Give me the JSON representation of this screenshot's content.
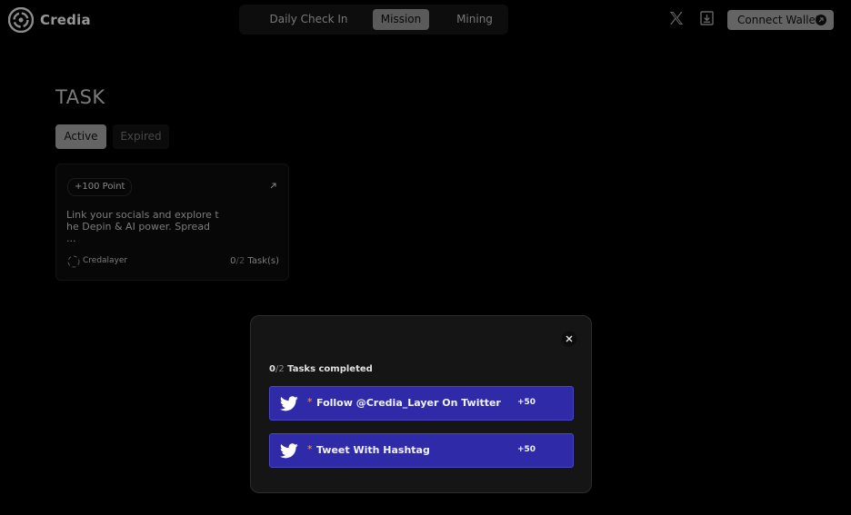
{
  "header": {
    "brand": "Credia",
    "nav_tabs": [
      {
        "label": "Daily Check In",
        "active": false
      },
      {
        "label": "Mission",
        "active": true
      },
      {
        "label": "Mining",
        "active": false
      }
    ],
    "connect_wallet": "Connect Wallet",
    "icons": [
      "x-logo-icon",
      "download-icon",
      "arrow-circle-icon"
    ]
  },
  "task": {
    "title": "TASK",
    "filters": [
      "Active",
      "Expired"
    ],
    "active_filter": "Active",
    "card": {
      "points": "+100 Point",
      "description": "Link your socials and explore the Depin & AI power. Spread ...",
      "owner": "Credalayer",
      "progress_done": "0",
      "progress_total": "/2",
      "progress_suffix": " Task(s)"
    }
  },
  "modal": {
    "completed_done": "0",
    "completed_total": "/2",
    "completed_suffix": " Tasks completed",
    "tasks": [
      {
        "label": "Follow @Credia_Layer On Twitter",
        "reward": "+50",
        "icon": "twitter-bird-icon"
      },
      {
        "label": "Tweet With Hashtag",
        "reward": "+50",
        "icon": "twitter-bird-icon"
      }
    ]
  },
  "colors": {
    "background": "#000000",
    "task_button": "#2f2ba8",
    "required_star": "#ff9a3c",
    "active_tab": "#8a8a8a"
  }
}
